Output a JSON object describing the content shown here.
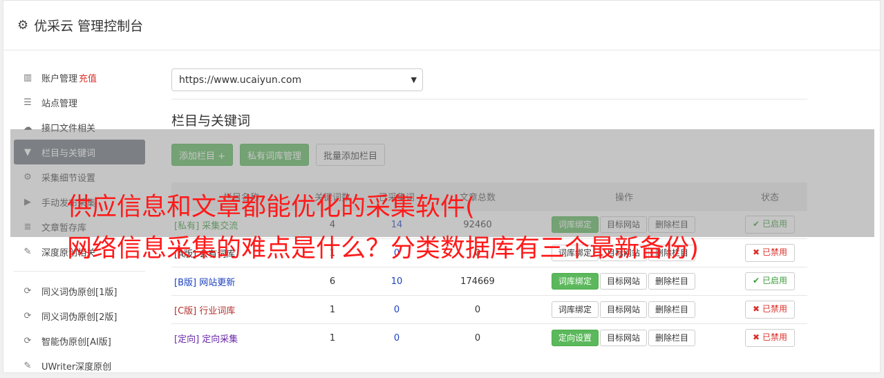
{
  "header": {
    "icon": "gear-icon",
    "title": "优采云 管理控制台"
  },
  "sidebar": {
    "items": [
      {
        "icon": "bar-chart-icon",
        "glyph": "▥",
        "label": "账户管理",
        "extra": "充值"
      },
      {
        "icon": "server-icon",
        "glyph": "☰",
        "label": "站点管理"
      },
      {
        "icon": "cloud-upload-icon",
        "glyph": "☁",
        "label": "接口文件相关"
      },
      {
        "icon": "filter-icon",
        "glyph": "▼",
        "label": "栏目与关键词",
        "active": true
      },
      {
        "icon": "cogs-icon",
        "glyph": "⚙",
        "label": "采集细节设置"
      },
      {
        "icon": "play-circle-icon",
        "glyph": "▶",
        "label": "手动发布采集"
      },
      {
        "icon": "database-icon",
        "glyph": "≣",
        "label": "文章暂存库"
      },
      {
        "icon": "edit-icon",
        "glyph": "✎",
        "label": "深度原创相关"
      }
    ],
    "items2": [
      {
        "icon": "refresh-icon",
        "glyph": "⟳",
        "label": "同义词伪原创[1版]"
      },
      {
        "icon": "refresh-icon",
        "glyph": "⟳",
        "label": "同义词伪原创[2版]"
      },
      {
        "icon": "refresh-icon",
        "glyph": "⟳",
        "label": "智能伪原创[AI版]"
      },
      {
        "icon": "edit-icon",
        "glyph": "✎",
        "label": "UWriter深度原创"
      }
    ]
  },
  "main": {
    "site_select": "https://www.ucaiyun.com",
    "section_title": "栏目与关键词",
    "buttons": {
      "add_column": "添加栏目 +",
      "private_lib": "私有词库管理",
      "batch_add": "批量添加栏目"
    },
    "table": {
      "headers": [
        "栏目名称",
        "关键词数",
        "已采集词",
        "文章总数",
        "操作",
        "状态"
      ],
      "rows": [
        {
          "tag": "[私有]",
          "name": "采集交流",
          "color": "#3c9a3c",
          "c1": "4",
          "c2": "14",
          "c3": "92460",
          "b1": "词库绑定",
          "b1_style": "g",
          "b2": "目标网站",
          "b3": "删除栏目",
          "status": "已启用",
          "on": true
        },
        {
          "tag": "[A版]",
          "name": "公有词库",
          "color": "#333333",
          "c1": "1",
          "c2": "0",
          "c3": "0",
          "b1": "词库绑定",
          "b1_style": "w",
          "b2": "目标网站",
          "b3": "删除栏目",
          "status": "已禁用",
          "on": false
        },
        {
          "tag": "[B版]",
          "name": "网站更新",
          "color": "#1a3fbf",
          "c1": "6",
          "c2": "10",
          "c3": "174669",
          "b1": "词库绑定",
          "b1_style": "g",
          "b2": "目标网站",
          "b3": "删除栏目",
          "status": "已启用",
          "on": true
        },
        {
          "tag": "[C版]",
          "name": "行业词库",
          "color": "#b0302a",
          "c1": "1",
          "c2": "0",
          "c3": "0",
          "b1": "词库绑定",
          "b1_style": "w",
          "b2": "目标网站",
          "b3": "删除栏目",
          "status": "已禁用",
          "on": false
        },
        {
          "tag": "[定向]",
          "name": "定向采集",
          "color": "#6a2aa8",
          "c1": "1",
          "c2": "0",
          "c3": "0",
          "b1": "定向设置",
          "b1_style": "g",
          "b2": "目标网站",
          "b3": "删除栏目",
          "status": "已禁用",
          "on": false
        }
      ]
    }
  },
  "overlay": {
    "line1": "供应信息和文章都能优化的采集软件(",
    "line2": "网络信息采集的难点是什么？分类数据库有三个最新备份)"
  }
}
